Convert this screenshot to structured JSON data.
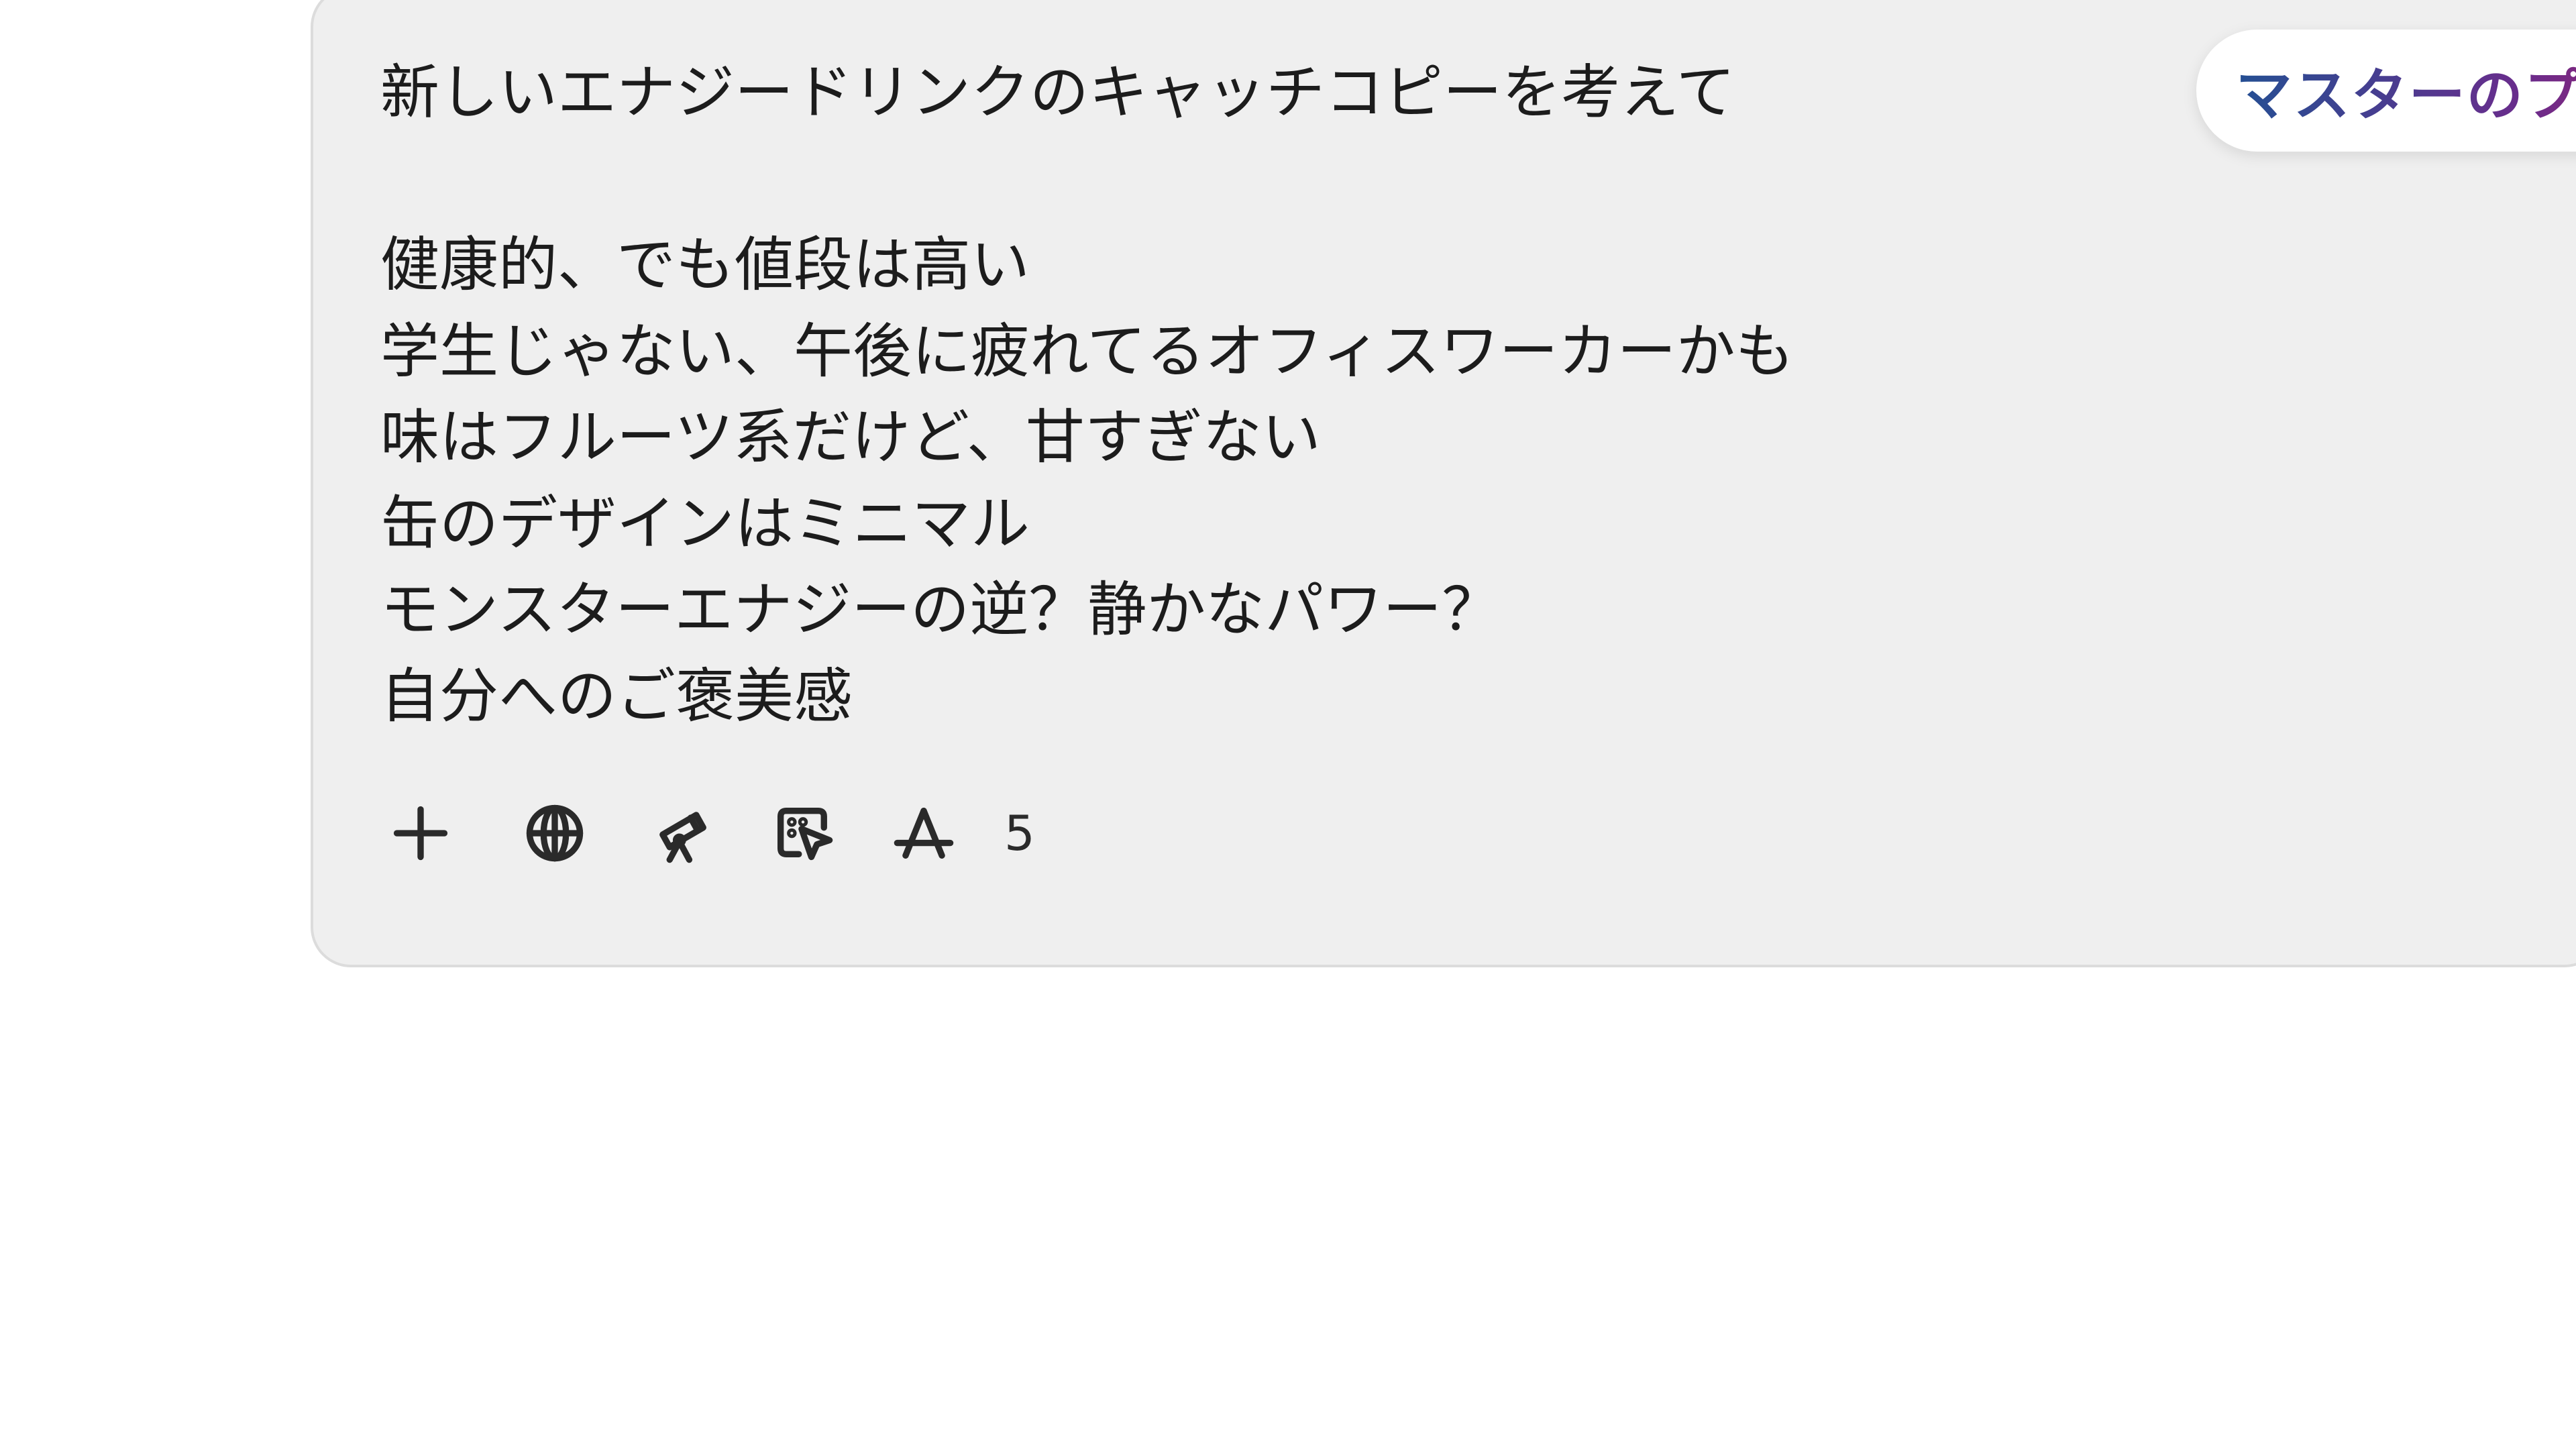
{
  "composer": {
    "prompt_lines": [
      "新しいエナジードリンクのキャッチコピーを考えて",
      "",
      "健康的、でも値段は高い",
      "学生じゃない、午後に疲れてるオフィスワーカーかも",
      "味はフルーツ系だけど、甘すぎない",
      "缶のデザインはミニマル",
      "モンスターエナジーの逆？静かなパワー？",
      "自分へのご褒美感"
    ]
  },
  "badge": {
    "label": "マスターのプロンプト",
    "gradient_colors": [
      "#244f93",
      "#6a2c8c",
      "#c21a54"
    ]
  },
  "toolbar": {
    "tools": [
      {
        "icon": "plus-icon"
      },
      {
        "icon": "globe-icon"
      },
      {
        "icon": "telescope-icon"
      },
      {
        "icon": "canvas-cursor-icon"
      },
      {
        "icon": "app-store-icon"
      }
    ],
    "count": "5"
  },
  "colors": {
    "composer_background": "#efefef",
    "text": "#1c1c1c"
  }
}
